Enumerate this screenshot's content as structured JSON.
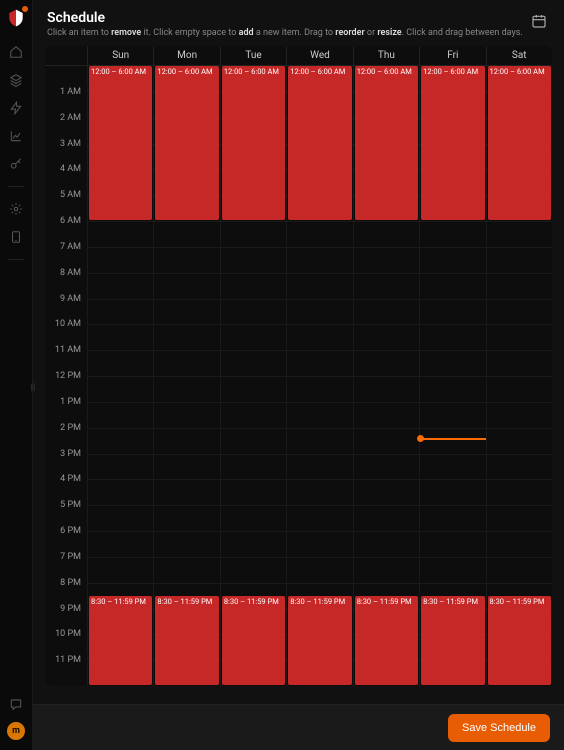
{
  "header": {
    "title": "Schedule",
    "subtitle_parts": [
      "Click an item to ",
      "remove",
      " it. Click empty space to ",
      "add",
      " a new item. Drag to ",
      "reorder",
      " or ",
      "resize",
      ". Click and drag between days."
    ]
  },
  "days": [
    "Sun",
    "Mon",
    "Tue",
    "Wed",
    "Thu",
    "Fri",
    "Sat"
  ],
  "hours": [
    "1 AM",
    "2 AM",
    "3 AM",
    "4 AM",
    "5 AM",
    "6 AM",
    "7 AM",
    "8 AM",
    "9 AM",
    "10 AM",
    "11 AM",
    "12 PM",
    "1 PM",
    "2 PM",
    "3 PM",
    "4 PM",
    "5 PM",
    "6 PM",
    "7 PM",
    "8 PM",
    "9 PM",
    "10 PM",
    "11 PM"
  ],
  "hour_count": 24,
  "events": [
    {
      "day": 0,
      "start": 0,
      "end": 6,
      "label": "12:00 – 6:00 AM"
    },
    {
      "day": 1,
      "start": 0,
      "end": 6,
      "label": "12:00 – 6:00 AM"
    },
    {
      "day": 2,
      "start": 0,
      "end": 6,
      "label": "12:00 – 6:00 AM"
    },
    {
      "day": 3,
      "start": 0,
      "end": 6,
      "label": "12:00 – 6:00 AM"
    },
    {
      "day": 4,
      "start": 0,
      "end": 6,
      "label": "12:00 – 6:00 AM"
    },
    {
      "day": 5,
      "start": 0,
      "end": 6,
      "label": "12:00 – 6:00 AM"
    },
    {
      "day": 6,
      "start": 0,
      "end": 6,
      "label": "12:00 – 6:00 AM"
    },
    {
      "day": 0,
      "start": 20.5,
      "end": 24,
      "label": "8:30 – 11:59 PM"
    },
    {
      "day": 1,
      "start": 20.5,
      "end": 24,
      "label": "8:30 – 11:59 PM"
    },
    {
      "day": 2,
      "start": 20.5,
      "end": 24,
      "label": "8:30 – 11:59 PM"
    },
    {
      "day": 3,
      "start": 20.5,
      "end": 24,
      "label": "8:30 – 11:59 PM"
    },
    {
      "day": 4,
      "start": 20.5,
      "end": 24,
      "label": "8:30 – 11:59 PM"
    },
    {
      "day": 5,
      "start": 20.5,
      "end": 24,
      "label": "8:30 – 11:59 PM"
    },
    {
      "day": 6,
      "start": 20.5,
      "end": 24,
      "label": "8:30 – 11:59 PM"
    }
  ],
  "now": {
    "day": 5,
    "hour": 14.4
  },
  "footer": {
    "save_label": "Save Schedule"
  },
  "avatar_initial": "m",
  "colors": {
    "event": "#c62828",
    "accent": "#e85d04",
    "now": "#ff6a00"
  }
}
